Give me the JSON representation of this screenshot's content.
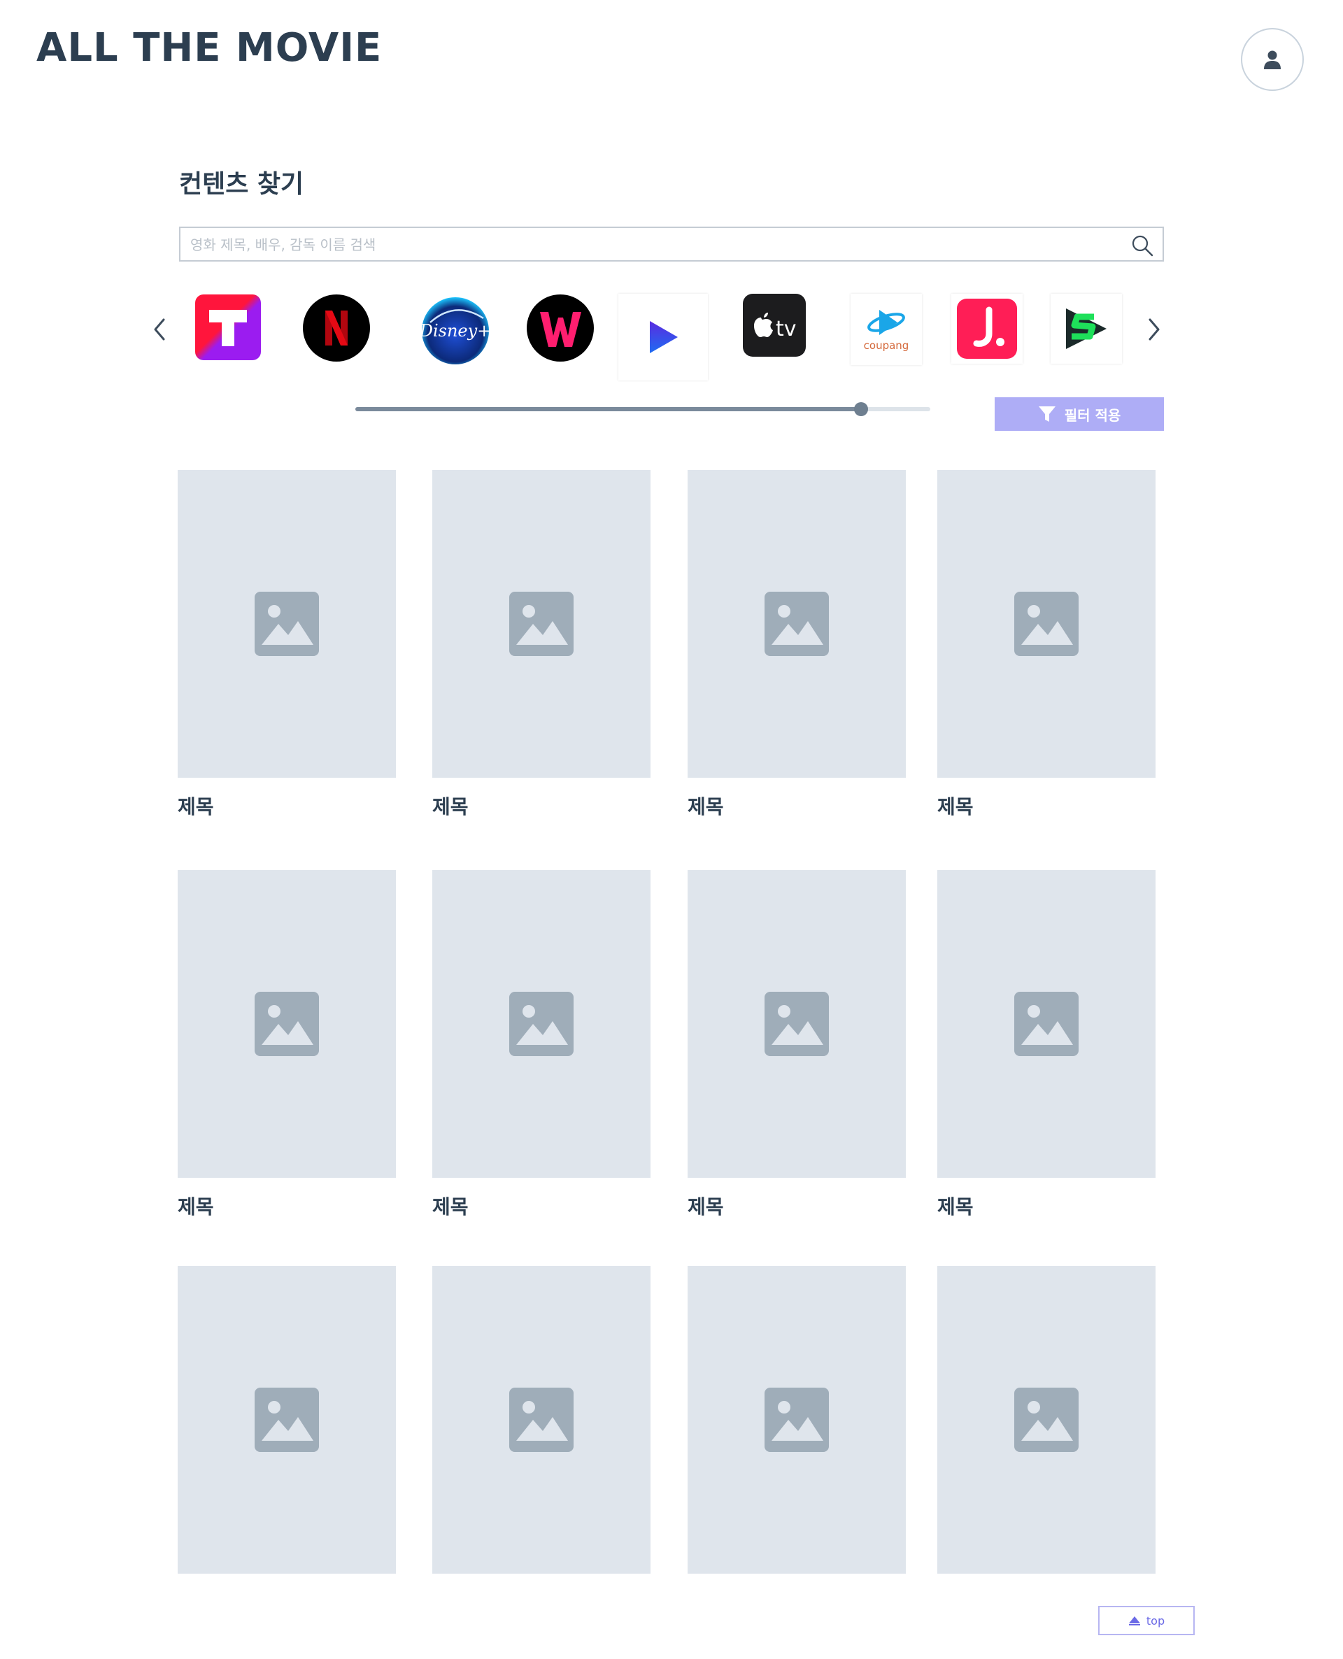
{
  "header": {
    "logo": "ALL THE MOVIE",
    "profile_icon": "user-icon"
  },
  "search_section": {
    "title": "컨텐츠 찾기",
    "search_placeholder": "영화 제목, 배우, 감독 이름 검색",
    "search_value": "",
    "search_icon": "search-icon"
  },
  "providers": {
    "prev_icon": "chevron-left-icon",
    "next_icon": "chevron-right-icon",
    "items": [
      {
        "name": "tving",
        "icon": "tving-logo"
      },
      {
        "name": "netflix",
        "icon": "netflix-logo"
      },
      {
        "name": "disney-plus",
        "icon": "disney-plus-logo"
      },
      {
        "name": "wavve",
        "icon": "wavve-logo"
      },
      {
        "name": "play",
        "icon": "play-logo"
      },
      {
        "name": "apple-tv",
        "icon": "apple-tv-logo"
      },
      {
        "name": "coupang-play",
        "icon": "coupang-logo"
      },
      {
        "name": "watcha",
        "icon": "watcha-logo"
      },
      {
        "name": "s-logo",
        "icon": "s-logo"
      }
    ],
    "colors": {
      "tving": "#ff153c",
      "netflix": "#e50914",
      "disney": "#0c2a7a",
      "wavve": "#ff1e6f",
      "play_blue": "#2a3ee8",
      "appletv": "#1c1c1e",
      "watcha": "#ff1e56",
      "s_green": "#1ee05a"
    }
  },
  "slider": {
    "value_fraction": 0.88
  },
  "filter": {
    "label": "필터 적용",
    "icon": "funnel-icon"
  },
  "grid": {
    "placeholder_icon": "image-placeholder-icon",
    "cards": [
      {
        "title": "제목"
      },
      {
        "title": "제목"
      },
      {
        "title": "제목"
      },
      {
        "title": "제목"
      },
      {
        "title": "제목"
      },
      {
        "title": "제목"
      },
      {
        "title": "제목"
      },
      {
        "title": "제목"
      },
      {
        "title": ""
      },
      {
        "title": ""
      },
      {
        "title": ""
      },
      {
        "title": ""
      }
    ]
  },
  "top_button": {
    "label": "top",
    "icon": "triangle-up-icon"
  },
  "theme": {
    "text": "#2c3e50",
    "placeholder_bg": "#dfe5ec",
    "accent": "#aeadf6"
  }
}
